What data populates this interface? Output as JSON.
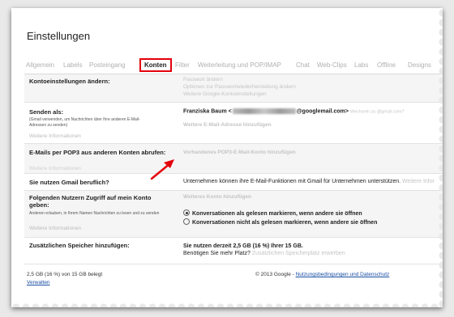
{
  "page": {
    "title": "Einstellungen"
  },
  "tabs": [
    {
      "label": "Allgemein",
      "active": false
    },
    {
      "label": "Labels",
      "active": false
    },
    {
      "label": "Posteingang",
      "active": false
    },
    {
      "label": "Konten",
      "active": true
    },
    {
      "label": "Filter",
      "active": false
    },
    {
      "label": "Weiterleitung und POP/IMAP",
      "active": false
    },
    {
      "label": "Chat",
      "active": false
    },
    {
      "label": "Web-Clips",
      "active": false
    },
    {
      "label": "Labs",
      "active": false
    },
    {
      "label": "Offline",
      "active": false
    },
    {
      "label": "Designs",
      "active": false
    }
  ],
  "sections": {
    "account": {
      "label": "Kontoeinstellungen ändern:",
      "links": [
        "Passwort ändern",
        "Optionen zur Passwortwiederherstellung ändern",
        "Weitere Google-Kontoeinstellungen"
      ]
    },
    "send_as": {
      "label": "Senden als:",
      "help": "(Gmail verwenden, um Nachrichten über Ihre anderen E-Mail-Adressen zu senden)",
      "info": "Weitere Informationen",
      "name": "Franziska Baum <",
      "address_suffix": "@googlemail.com>",
      "hint": "Wechseln zu @gmail.com?",
      "add_link": "Weitere E-Mail-Adresse hinzufügen"
    },
    "pop3": {
      "label": "E-Mails per POP3 aus anderen Konten abrufen:",
      "info": "Weitere Informationen",
      "add_link": "Vorhandenes POP3-E-Mail-Konto hinzufügen"
    },
    "business": {
      "label": "Sie nutzen Gmail beruflich?",
      "text": "Unternehmen können ihre E-Mail-Funktionen mit Gmail für Unternehmen unterstützen.",
      "info": "Weitere Infor"
    },
    "access": {
      "label": "Folgenden Nutzern Zugriff auf mein Konto geben:",
      "help": "Anderen erlauben, in Ihrem Namen Nachrichten zu lesen und zu senden",
      "info": "Weitere Informationen",
      "add_link": "Weiteres Konto hinzufügen",
      "options": [
        {
          "label": "Konversationen als gelesen markieren, wenn andere sie öffnen",
          "selected": true
        },
        {
          "label": "Konversationen nicht als gelesen markieren, wenn andere sie öffnen",
          "selected": false
        }
      ]
    },
    "storage": {
      "label": "Zusätzlichen Speicher hinzufügen:",
      "usage": "Sie nutzen derzeit 2,5 GB (16 %) Ihrer 15 GB.",
      "question": "Benötigen Sie mehr Platz?",
      "buy_link": "Zusätzlichen Speicherplatz erwerben"
    }
  },
  "footer": {
    "usage": "2,5 GB (16 %) von 15 GB belegt",
    "manage": "Verwalten",
    "copyright": "© 2013 Google - ",
    "terms": "Nutzungsbedingungen und Datenschutz"
  },
  "colors": {
    "highlight": "#e3000b",
    "link": "#1a4ea3",
    "faded": "#c4c4c4"
  },
  "icons": {
    "arrow": "red-arrow-icon"
  }
}
